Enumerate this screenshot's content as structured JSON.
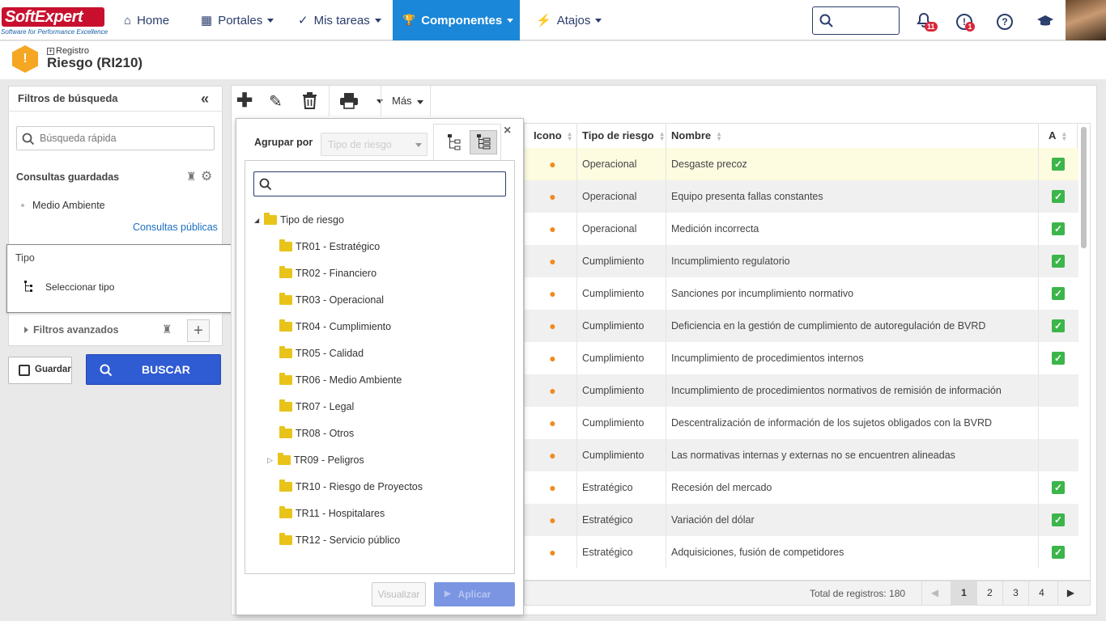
{
  "brand": {
    "logo": "SoftExpert",
    "tagline": "Software for Performance Excellence"
  },
  "nav": [
    {
      "label": "Home",
      "icon": "home-icon",
      "glyph": "⌂"
    },
    {
      "label": "Portales",
      "icon": "grid-icon",
      "glyph": "▦"
    },
    {
      "label": "Mis tareas",
      "icon": "check-icon",
      "glyph": "✓"
    },
    {
      "label": "Componentes",
      "icon": "trophy-icon",
      "glyph": "🏆"
    },
    {
      "label": "Atajos",
      "icon": "bolt-icon",
      "glyph": "⚡"
    }
  ],
  "topicons": {
    "notif_badge": "11",
    "alert_badge": "1",
    "help": "?"
  },
  "header": {
    "breadcrumb": "Registro",
    "title": "Riesgo (RI210)"
  },
  "filters": {
    "title": "Filtros de búsqueda",
    "quick_search_placeholder": "Búsqueda rápida",
    "saved_title": "Consultas guardadas",
    "saved_items": [
      "Medio Ambiente"
    ],
    "public_link": "Consultas públicas",
    "type_title": "Tipo",
    "select_type": "Seleccionar tipo",
    "advanced": "Filtros avanzados",
    "save_btn": "Guardar",
    "search_btn": "BUSCAR"
  },
  "toolbar": {
    "more": "Más"
  },
  "popup": {
    "group_by": "Agrupar por",
    "group_select": "Tipo de riesgo",
    "root": "Tipo de riesgo",
    "items": [
      "TR01 - Estratégico",
      "TR02 - Financiero",
      "TR03 - Operacional",
      "TR04 - Cumplimiento",
      "TR05 - Calidad",
      "TR06 - Medio Ambiente",
      "TR07 - Legal",
      "TR08 - Otros",
      "TR09 - Peligros",
      "TR10 - Riesgo de Proyectos",
      "TR11 - Hospitalares",
      "TR12 - Servicio público"
    ],
    "view_btn": "Visualizar",
    "apply_btn": "Aplicar"
  },
  "table": {
    "columns": [
      "Icono",
      "Tipo de riesgo",
      "Nombre",
      "A"
    ],
    "rows": [
      {
        "tipo": "Operacional",
        "nombre": "Desgaste precoz",
        "a": true
      },
      {
        "tipo": "Operacional",
        "nombre": "Equipo presenta fallas constantes",
        "a": true
      },
      {
        "tipo": "Operacional",
        "nombre": "Medición incorrecta",
        "a": true
      },
      {
        "tipo": "Cumplimiento",
        "nombre": "Incumplimiento regulatorio",
        "a": true
      },
      {
        "tipo": "Cumplimiento",
        "nombre": "Sanciones por incumplimiento normativo",
        "a": true
      },
      {
        "tipo": "Cumplimiento",
        "nombre": "Deficiencia en la gestión de cumplimiento de autoregulación de BVRD",
        "a": true
      },
      {
        "tipo": "Cumplimiento",
        "nombre": "Incumplimiento de procedimientos internos",
        "a": true
      },
      {
        "tipo": "Cumplimiento",
        "nombre": "Incumplimiento de procedimientos normativos de remisión de información",
        "a": false
      },
      {
        "tipo": "Cumplimiento",
        "nombre": "Descentralización de información de los sujetos obligados con la BVRD",
        "a": false
      },
      {
        "tipo": "Cumplimiento",
        "nombre": "Las normativas internas y externas no se encuentren alineadas",
        "a": false
      },
      {
        "tipo": "Estratégico",
        "nombre": "Recesión del mercado",
        "a": true
      },
      {
        "tipo": "Estratégico",
        "nombre": "Variación del dólar",
        "a": true
      },
      {
        "tipo": "Estratégico",
        "nombre": "Adquisiciones, fusión de competidores",
        "a": true
      }
    ],
    "total": "Total de registros: 180",
    "pages": [
      "1",
      "2",
      "3",
      "4"
    ],
    "current_page": "1"
  },
  "colors": {
    "accent": "#1b87d8",
    "primary_btn": "#2f5bd3",
    "check": "#3cb54a",
    "highlight": "#fdfbe0"
  }
}
